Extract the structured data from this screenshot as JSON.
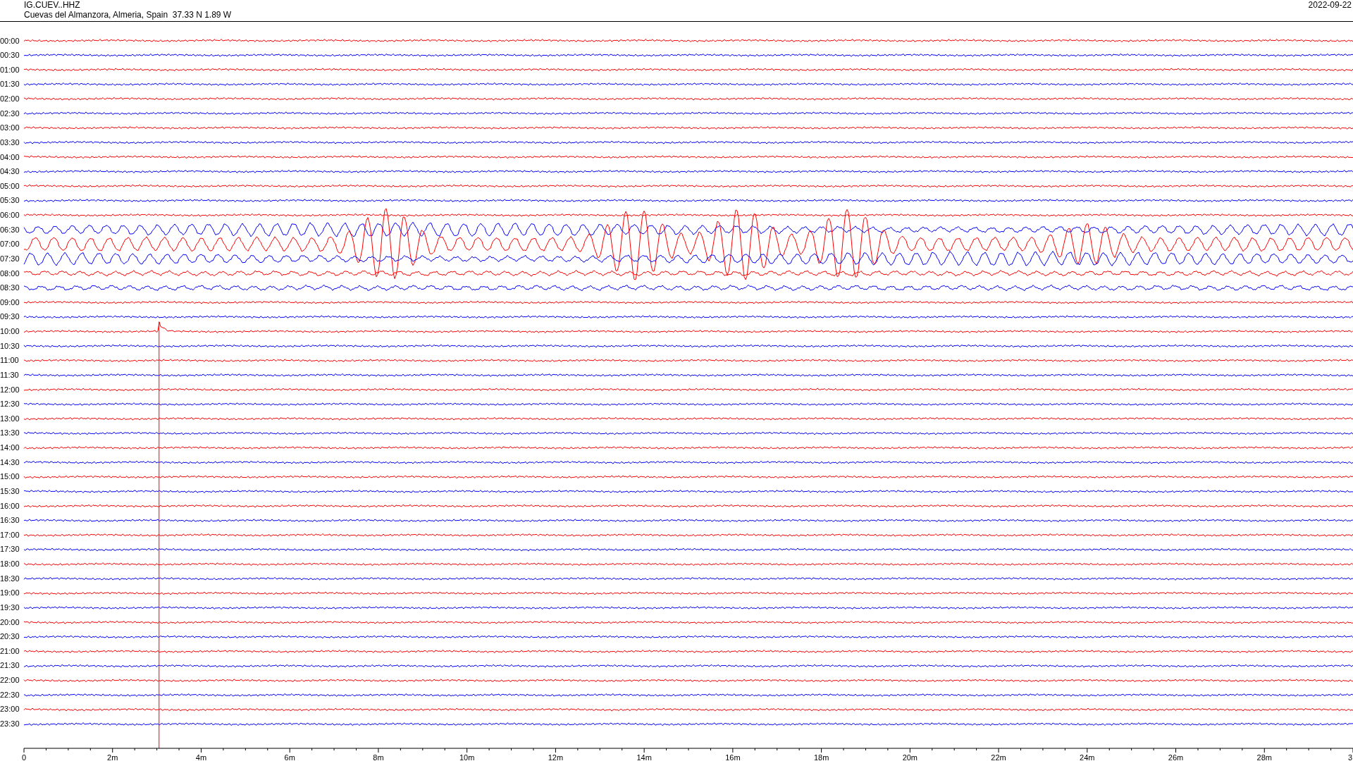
{
  "header": {
    "station": "IG.CUEV..HHZ",
    "location": "Cuevas del Almanzora, Almeria, Spain  37.33 N 1.89 W",
    "date": "2022-09-22"
  },
  "rows": [
    {
      "label": "00:00",
      "color": "#ff0000",
      "kind": "quiet"
    },
    {
      "label": "00:30",
      "color": "#0000ff",
      "kind": "quiet"
    },
    {
      "label": "01:00",
      "color": "#ff0000",
      "kind": "quiet"
    },
    {
      "label": "01:30",
      "color": "#0000ff",
      "kind": "quiet"
    },
    {
      "label": "02:00",
      "color": "#ff0000",
      "kind": "quiet"
    },
    {
      "label": "02:30",
      "color": "#0000ff",
      "kind": "quiet"
    },
    {
      "label": "03:00",
      "color": "#ff0000",
      "kind": "quiet"
    },
    {
      "label": "03:30",
      "color": "#0000ff",
      "kind": "quiet"
    },
    {
      "label": "04:00",
      "color": "#ff0000",
      "kind": "quiet"
    },
    {
      "label": "04:30",
      "color": "#0000ff",
      "kind": "quiet"
    },
    {
      "label": "05:00",
      "color": "#ff0000",
      "kind": "quiet"
    },
    {
      "label": "05:30",
      "color": "#0000ff",
      "kind": "quiet"
    },
    {
      "label": "06:00",
      "color": "#ff0000",
      "kind": "quiet"
    },
    {
      "label": "06:30",
      "color": "#0000ff",
      "kind": "swell"
    },
    {
      "label": "07:00",
      "color": "#ff0000",
      "kind": "burst"
    },
    {
      "label": "07:30",
      "color": "#0000ff",
      "kind": "swell"
    },
    {
      "label": "08:00",
      "color": "#ff0000",
      "kind": "ripple"
    },
    {
      "label": "08:30",
      "color": "#0000ff",
      "kind": "ripple"
    },
    {
      "label": "09:00",
      "color": "#ff0000",
      "kind": "quiet"
    },
    {
      "label": "09:30",
      "color": "#0000ff",
      "kind": "quiet"
    },
    {
      "label": "10:00",
      "color": "#ff0000",
      "kind": "spike"
    },
    {
      "label": "10:30",
      "color": "#0000ff",
      "kind": "quiet"
    },
    {
      "label": "11:00",
      "color": "#ff0000",
      "kind": "quiet"
    },
    {
      "label": "11:30",
      "color": "#0000ff",
      "kind": "quiet"
    },
    {
      "label": "12:00",
      "color": "#ff0000",
      "kind": "quiet"
    },
    {
      "label": "12:30",
      "color": "#0000ff",
      "kind": "quiet"
    },
    {
      "label": "13:00",
      "color": "#ff0000",
      "kind": "quiet"
    },
    {
      "label": "13:30",
      "color": "#0000ff",
      "kind": "quiet"
    },
    {
      "label": "14:00",
      "color": "#ff0000",
      "kind": "quiet"
    },
    {
      "label": "14:30",
      "color": "#0000ff",
      "kind": "quiet"
    },
    {
      "label": "15:00",
      "color": "#ff0000",
      "kind": "quiet"
    },
    {
      "label": "15:30",
      "color": "#0000ff",
      "kind": "quiet"
    },
    {
      "label": "16:00",
      "color": "#ff0000",
      "kind": "quiet"
    },
    {
      "label": "16:30",
      "color": "#0000ff",
      "kind": "quiet"
    },
    {
      "label": "17:00",
      "color": "#ff0000",
      "kind": "quiet"
    },
    {
      "label": "17:30",
      "color": "#0000ff",
      "kind": "quiet"
    },
    {
      "label": "18:00",
      "color": "#ff0000",
      "kind": "quiet"
    },
    {
      "label": "18:30",
      "color": "#0000ff",
      "kind": "quiet"
    },
    {
      "label": "19:00",
      "color": "#ff0000",
      "kind": "quiet"
    },
    {
      "label": "19:30",
      "color": "#0000ff",
      "kind": "quiet"
    },
    {
      "label": "20:00",
      "color": "#ff0000",
      "kind": "quiet"
    },
    {
      "label": "20:30",
      "color": "#0000ff",
      "kind": "quiet"
    },
    {
      "label": "21:00",
      "color": "#ff0000",
      "kind": "quiet"
    },
    {
      "label": "21:30",
      "color": "#0000ff",
      "kind": "quiet"
    },
    {
      "label": "22:00",
      "color": "#ff0000",
      "kind": "quiet"
    },
    {
      "label": "22:30",
      "color": "#0000ff",
      "kind": "quiet"
    },
    {
      "label": "23:00",
      "color": "#ff0000",
      "kind": "quiet"
    },
    {
      "label": "23:30",
      "color": "#0000ff",
      "kind": "quiet"
    }
  ],
  "axis": {
    "labels": [
      "0",
      "2m",
      "4m",
      "6m",
      "8m",
      "10m",
      "12m",
      "14m",
      "16m",
      "18m",
      "20m",
      "22m",
      "24m",
      "26m",
      "28m",
      "3"
    ]
  }
}
